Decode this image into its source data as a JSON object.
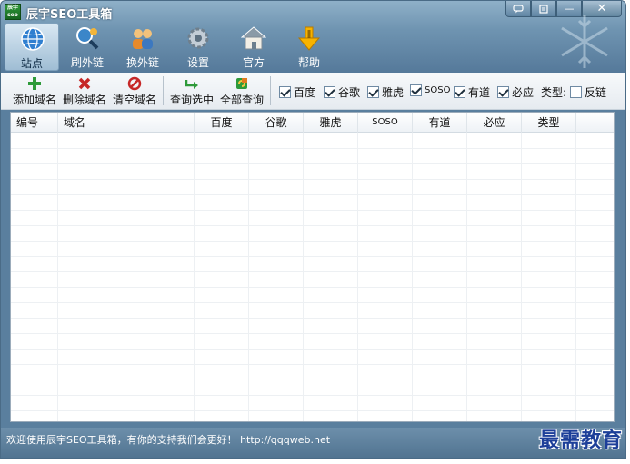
{
  "window": {
    "title": "辰宇SEO工具箱",
    "logo_text": "辰宇seo"
  },
  "nav": {
    "items": [
      {
        "label": "站点",
        "icon": "globe-icon",
        "active": true
      },
      {
        "label": "刷外链",
        "icon": "link-search-icon",
        "active": false
      },
      {
        "label": "换外链",
        "icon": "users-exchange-icon",
        "active": false
      },
      {
        "label": "设置",
        "icon": "gear-icon",
        "active": false
      },
      {
        "label": "官方",
        "icon": "home-icon",
        "active": false
      },
      {
        "label": "帮助",
        "icon": "help-arrow-icon",
        "active": false
      }
    ]
  },
  "toolbar": {
    "add_domain": "添加域名",
    "delete_domain": "删除域名",
    "clear_domain": "清空域名",
    "query_selected": "查询选中",
    "query_all": "全部查询",
    "checks": [
      {
        "label": "百度",
        "checked": true
      },
      {
        "label": "谷歌",
        "checked": true
      },
      {
        "label": "雅虎",
        "checked": true
      },
      {
        "label": "SOSO",
        "checked": true
      },
      {
        "label": "有道",
        "checked": true
      },
      {
        "label": "必应",
        "checked": true
      }
    ],
    "type_label": "类型:",
    "backlink_label": "反链",
    "backlink_checked": false
  },
  "table": {
    "columns": [
      "编号",
      "域名",
      "百度",
      "谷歌",
      "雅虎",
      "SOSO",
      "有道",
      "必应",
      "类型"
    ],
    "rows": []
  },
  "status": {
    "text": "欢迎使用辰宇SEO工具箱，有你的支持我们会更好！ http://qqqweb.net"
  },
  "watermark": "最需教育",
  "colors": {
    "header": "#6f94b1",
    "statusbar": "#5a7f9e",
    "add": "#2e9a3a",
    "delete": "#c62828"
  }
}
